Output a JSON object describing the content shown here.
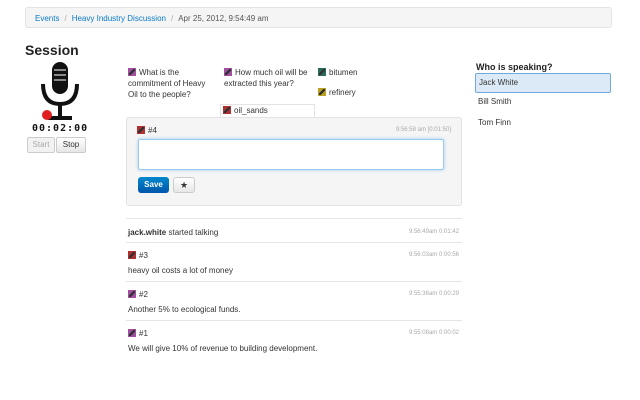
{
  "breadcrumb": {
    "items": [
      "Events",
      "Heavy Industry Discussion"
    ],
    "current": "Apr 25, 2012, 9:54:49 am"
  },
  "session": {
    "title": "Session",
    "timer": "00:02:00",
    "start_label": "Start",
    "stop_label": "Stop"
  },
  "tags": [
    {
      "lines": [
        "What is the",
        "commitment of Heavy",
        "Oil to the people?"
      ],
      "color": "#a050a0"
    },
    {
      "lines": [
        "How much oil will be",
        "extracted this year?"
      ],
      "color": "#a050a0"
    },
    {
      "lines": [
        "bitumen"
      ],
      "color": "#2a6a5a"
    },
    {
      "lines": [
        "refinery"
      ],
      "color": "#b8a020"
    },
    {
      "lines": [
        "oil_sands"
      ],
      "color": "#b03030"
    }
  ],
  "editor": {
    "number": "#4",
    "time": "9:56:58 am [0:01:50]",
    "save_label": "Save",
    "star_label": "★"
  },
  "feed": [
    {
      "type": "talk",
      "user": "jack.white",
      "action": " started talking",
      "time": "9:56:49am 0:01:42"
    },
    {
      "type": "note",
      "number": "#3",
      "text": "heavy oil costs a lot of money",
      "time": "9:56:03am 0:00:56",
      "color": "#b03030"
    },
    {
      "type": "note",
      "number": "#2",
      "text": "Another 5% to ecological funds.",
      "time": "9:55:36am 0:00:29",
      "color": "#a050a0"
    },
    {
      "type": "note",
      "number": "#1",
      "text": "We will give 10% of revenue to building development.",
      "time": "9:55:08am 0:00:02",
      "color": "#a050a0"
    }
  ],
  "speaking": {
    "title": "Who is speaking?",
    "speakers": [
      "Jack White",
      "Bill Smith",
      "Tom Finn"
    ],
    "active": "Jack White"
  },
  "colors": {
    "link": "#0a7ac8",
    "primary": "#0077c0",
    "record": "#e02020"
  }
}
